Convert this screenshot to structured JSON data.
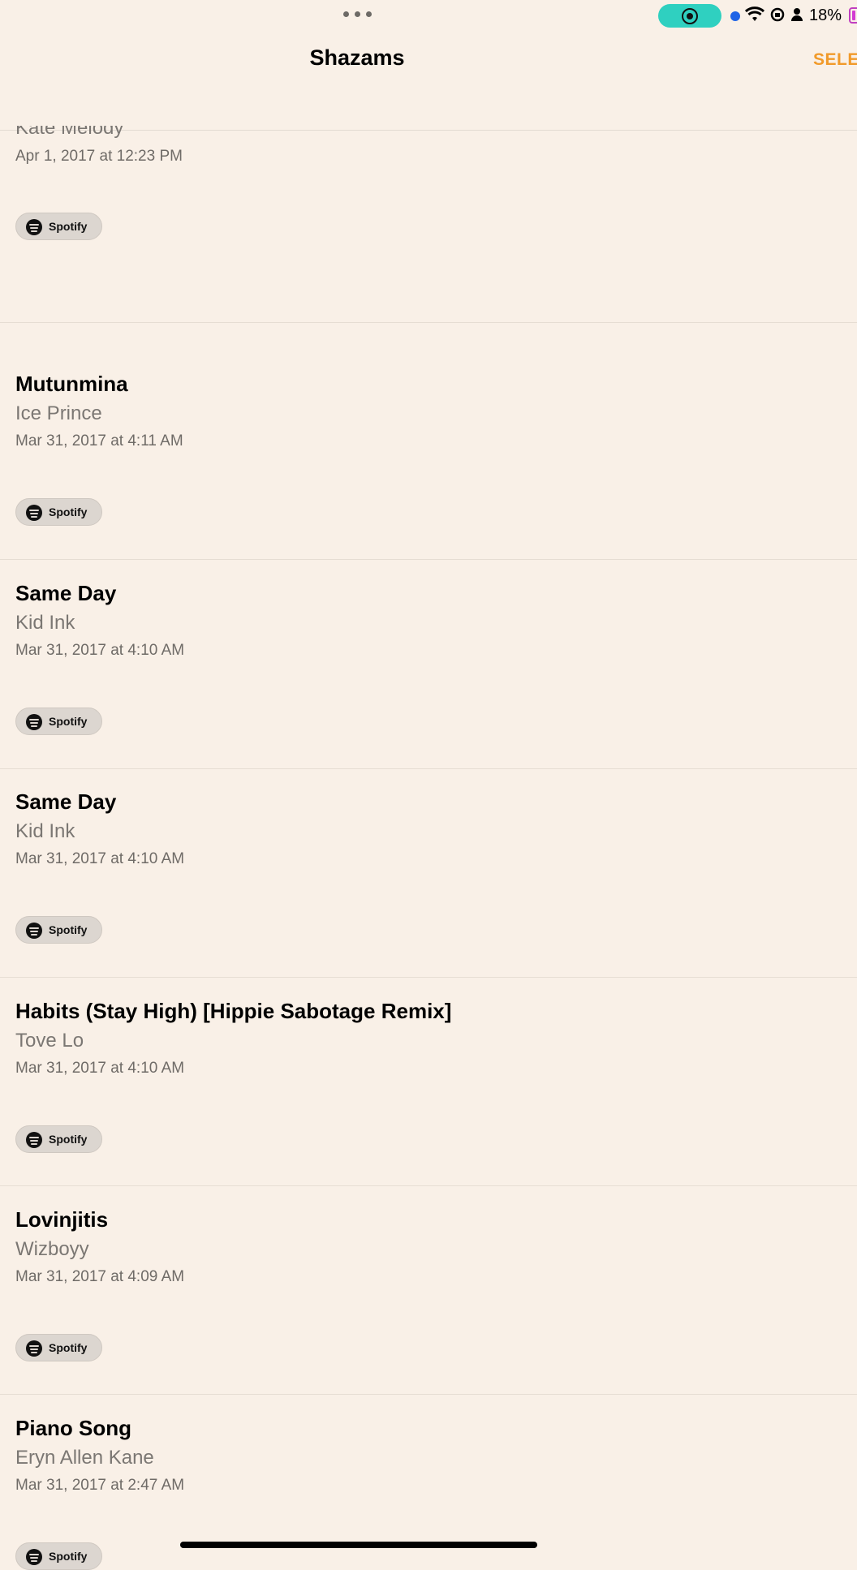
{
  "status_bar": {
    "battery": "18%",
    "icons": [
      "record-icon",
      "wifi-icon",
      "screen-lock-icon",
      "person-icon",
      "battery-icon"
    ],
    "accent_record": "#2fd0c0"
  },
  "nav": {
    "title": "Shazams",
    "select_label": "SELE"
  },
  "list": {
    "top_partial": {
      "artist": "Kate Melody",
      "date": "Apr 1, 2017 at 12:23 PM",
      "spotify_label": "Spotify"
    },
    "items": [
      {
        "title": "Mutunmina",
        "artist": "Ice Prince",
        "date": "Mar 31, 2017 at 4:11 AM",
        "spotify_label": "Spotify"
      },
      {
        "title": "Same Day",
        "artist": "Kid Ink",
        "date": "Mar 31, 2017 at 4:10 AM",
        "spotify_label": "Spotify"
      },
      {
        "title": "Same Day",
        "artist": "Kid Ink",
        "date": "Mar 31, 2017 at 4:10 AM",
        "spotify_label": "Spotify"
      },
      {
        "title": "Habits (Stay High) [Hippie Sabotage Remix]",
        "artist": "Tove Lo",
        "date": "Mar 31, 2017 at 4:10 AM",
        "spotify_label": "Spotify"
      },
      {
        "title": "Lovinjitis",
        "artist": "Wizboyy",
        "date": "Mar 31, 2017 at 4:09 AM",
        "spotify_label": "Spotify"
      },
      {
        "title": "Piano Song",
        "artist": "Eryn Allen Kane",
        "date": "Mar 31, 2017 at 2:47 AM",
        "spotify_label": "Spotify"
      }
    ]
  },
  "colors": {
    "background": "#f9f0e7",
    "accent": "#f19a2a"
  }
}
